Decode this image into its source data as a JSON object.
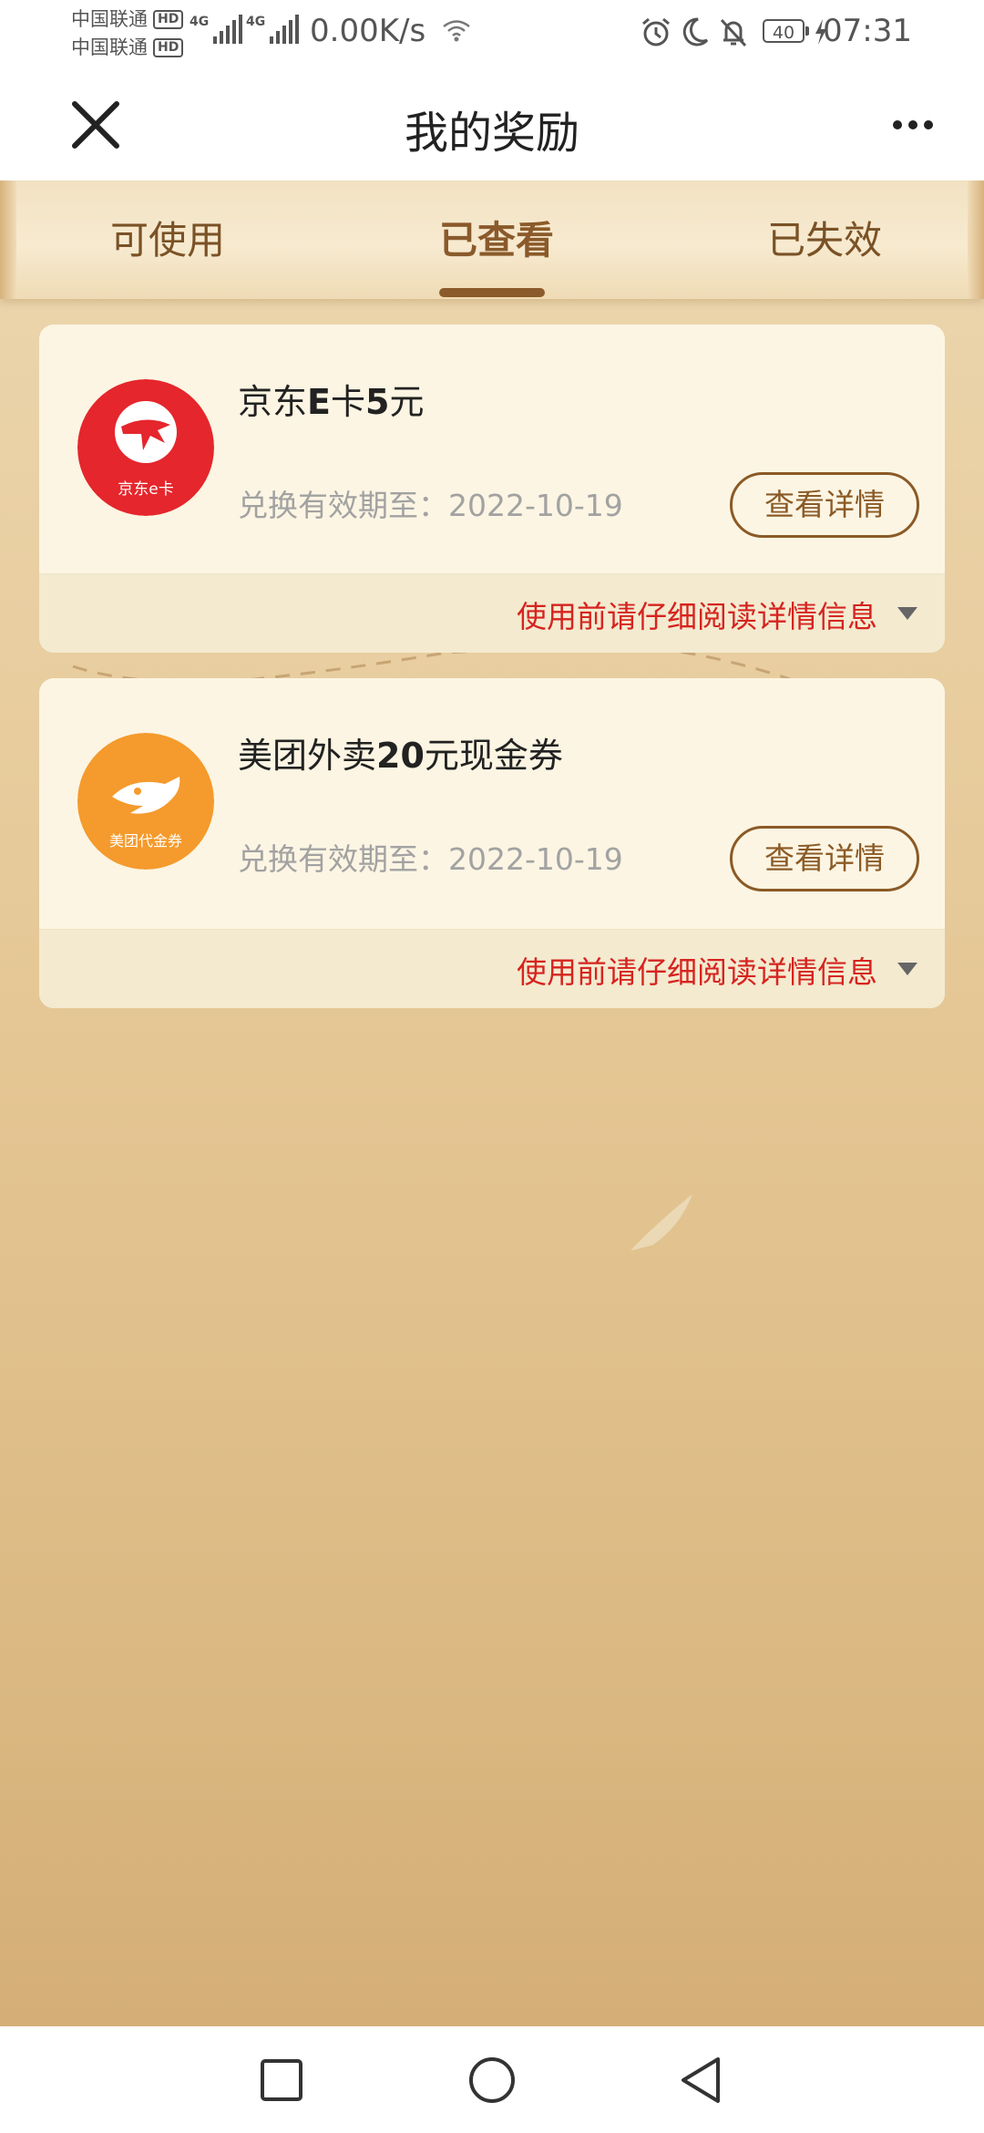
{
  "status_bar": {
    "carrier_1": "中国联通",
    "carrier_2": "中国联通",
    "hd_badge": "HD",
    "network_1": "4G",
    "network_2": "4G",
    "speed": "0.00K/s",
    "battery": "40",
    "time": "07:31",
    "icons": [
      "wifi-icon",
      "alarm-icon",
      "moon-icon",
      "mute-bell-icon",
      "battery-icon",
      "charging-icon"
    ]
  },
  "header": {
    "title": "我的奖励",
    "close_icon": "close-icon",
    "more_icon": "more-dots-icon"
  },
  "tabs": [
    {
      "label": "可使用",
      "active": false
    },
    {
      "label": "已查看",
      "active": true
    },
    {
      "label": "已失效",
      "active": false
    }
  ],
  "rewards": [
    {
      "title_prefix": "京东",
      "title_bold_1": "E",
      "title_mid": "卡",
      "title_bold_2": "5",
      "title_suffix": "元",
      "logo_text": "京东e卡",
      "logo_color": "#e5262c",
      "date_label": "兑换有效期至：",
      "date": "2022-10-19",
      "detail_button": "查看详情",
      "footer_note": "使用前请仔细阅读详情信息"
    },
    {
      "title_prefix": "美团外卖",
      "title_bold_1": "20",
      "title_mid": "元现金券",
      "logo_text": "美团代金券",
      "logo_color": "#f59a2c",
      "date_label": "兑换有效期至：",
      "date": "2022-10-19",
      "detail_button": "查看详情",
      "footer_note": "使用前请仔细阅读详情信息"
    }
  ],
  "colors": {
    "accent_brown": "#8b5a26",
    "warning_red": "#d6241f",
    "card_bg": "#fcf5e3"
  },
  "system_nav": [
    "recent-apps-icon",
    "home-icon",
    "back-icon"
  ]
}
